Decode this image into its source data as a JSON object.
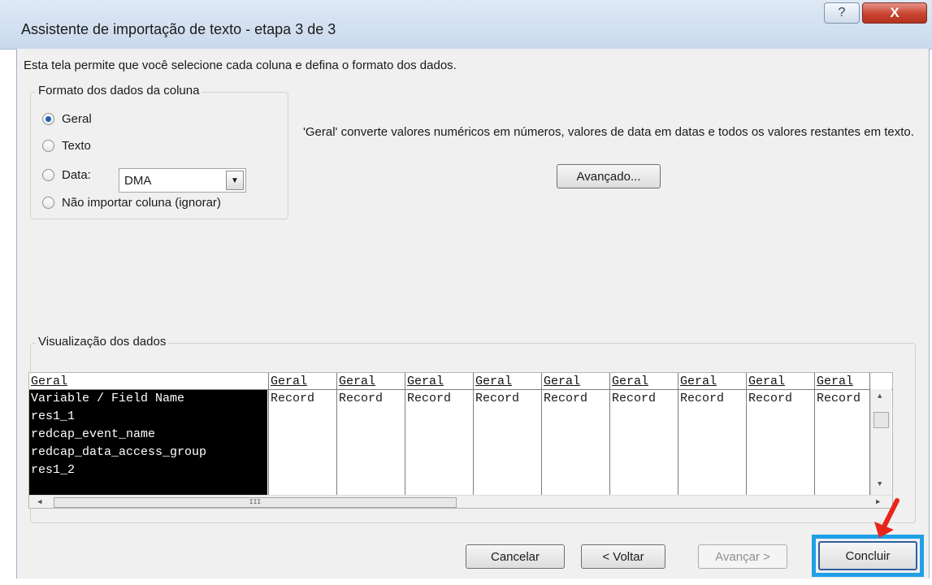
{
  "window": {
    "title": "Assistente de importação de texto - etapa 3 de 3",
    "help_icon": "question-mark",
    "help_glyph": "?",
    "close_icon": "close-x",
    "close_glyph": "X"
  },
  "intro": "Esta tela permite que você selecione cada coluna e defina o formato dos dados.",
  "column_format": {
    "label": "Formato dos dados da coluna",
    "options": [
      {
        "label": "Geral",
        "selected": true
      },
      {
        "label": "Texto",
        "selected": false
      },
      {
        "label": "Data:",
        "selected": false
      },
      {
        "label": "Não importar coluna (ignorar)",
        "selected": false
      }
    ],
    "date_format": "DMA"
  },
  "description": "'Geral' converte valores numéricos em números, valores de data em datas e todos os valores restantes em texto.",
  "advanced_button": "Avançado...",
  "preview": {
    "label": "Visualização dos dados",
    "headers": [
      "Geral",
      "Geral",
      "Geral",
      "Geral",
      "Geral",
      "Geral",
      "Geral",
      "Geral",
      "Geral",
      "Geral"
    ],
    "first_column": [
      "Variable / Field Name",
      "res1_1",
      "redcap_event_name",
      "redcap_data_access_group",
      "res1_2"
    ],
    "row1_values": [
      "Record",
      "Record",
      "Record",
      "Record",
      "Record",
      "Record",
      "Record",
      "Record",
      "Record"
    ],
    "hscroll_grip": "III"
  },
  "buttons": {
    "cancel": "Cancelar",
    "back": "< Voltar",
    "next": "Avançar >",
    "finish": "Concluir"
  },
  "colors": {
    "selection_bg": "#000000",
    "focus_ring": "#1fa0e6",
    "annotation_arrow": "#e8251b",
    "close_button": "#c9432f"
  }
}
